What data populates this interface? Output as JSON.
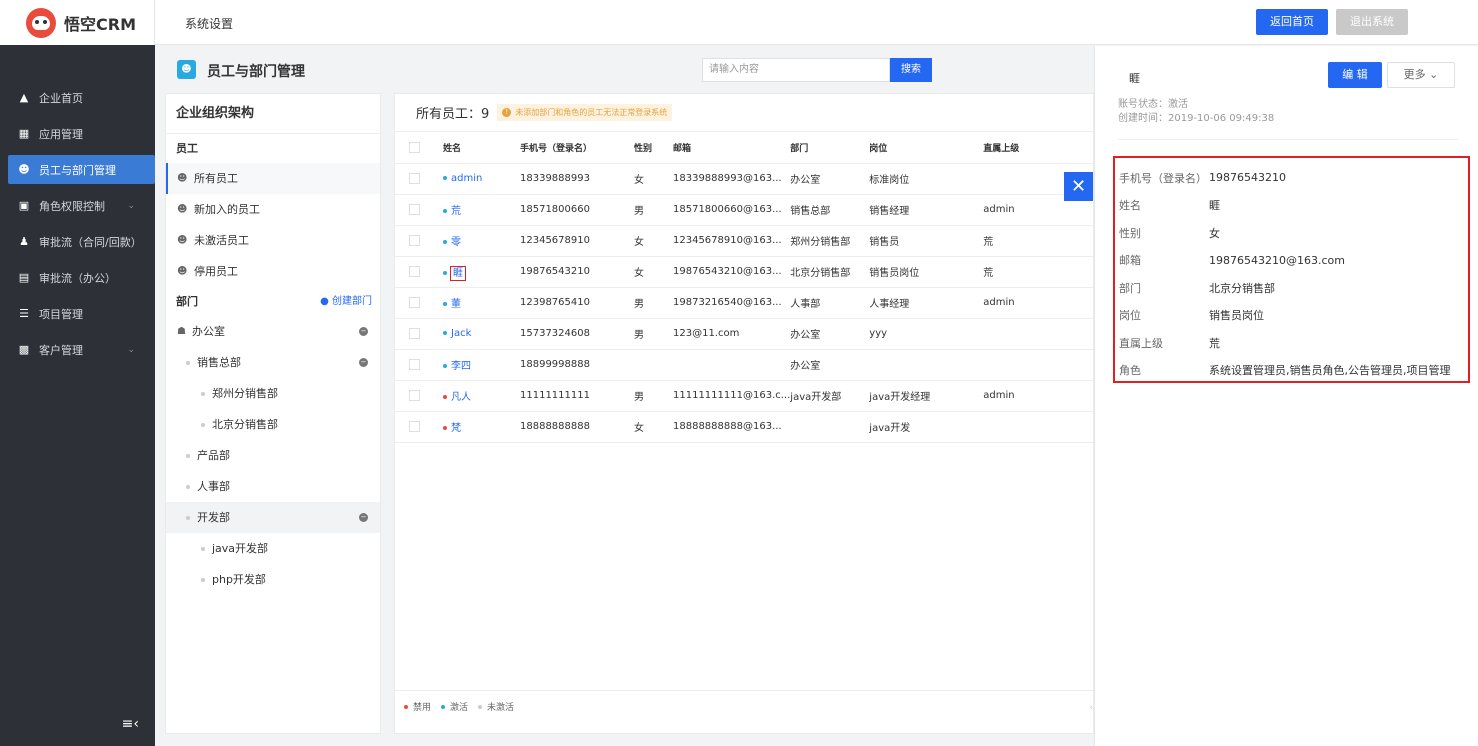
{
  "app": {
    "name": "悟空CRM"
  },
  "sidebar": {
    "items": [
      {
        "label": "企业首页",
        "icon": "home-icon"
      },
      {
        "label": "应用管理",
        "icon": "apps-icon"
      },
      {
        "label": "员工与部门管理",
        "icon": "users-icon",
        "active": true
      },
      {
        "label": "角色权限控制",
        "icon": "role-icon",
        "has_children": true
      },
      {
        "label": "审批流（合同/回款）",
        "icon": "approval-icon"
      },
      {
        "label": "审批流（办公）",
        "icon": "office-icon"
      },
      {
        "label": "项目管理",
        "icon": "project-icon"
      },
      {
        "label": "客户管理",
        "icon": "customer-icon",
        "has_children": true
      }
    ]
  },
  "header": {
    "title": "系统设置",
    "home_button": "返回首页",
    "logout_button": "退出系统"
  },
  "page": {
    "title": "员工与部门管理",
    "search_placeholder": "请输入内容",
    "search_button": "搜索"
  },
  "org": {
    "title": "企业组织架构",
    "employee_section": "员工",
    "employee_filters": [
      "所有员工",
      "新加入的员工",
      "未激活员工",
      "停用员工"
    ],
    "dept_section": "部门",
    "create_dept": "创建部门",
    "depts": [
      {
        "label": "办公室",
        "level": 0,
        "toggle": true
      },
      {
        "label": "销售总部",
        "level": 1,
        "toggle": true
      },
      {
        "label": "郑州分销售部",
        "level": 2
      },
      {
        "label": "北京分销售部",
        "level": 2
      },
      {
        "label": "产品部",
        "level": 1
      },
      {
        "label": "人事部",
        "level": 1
      },
      {
        "label": "开发部",
        "level": 1,
        "toggle": true,
        "active": true
      },
      {
        "label": "java开发部",
        "level": 2
      },
      {
        "label": "php开发部",
        "level": 2
      }
    ]
  },
  "employees": {
    "count_label": "所有员工：9",
    "warning": "未添加部门和角色的员工无法正常登录系统",
    "columns": [
      "姓名",
      "手机号（登录名）",
      "性别",
      "邮箱",
      "部门",
      "岗位",
      "直属上级"
    ],
    "rows": [
      {
        "name": "admin",
        "status": "active",
        "phone": "18339888993",
        "gender": "女",
        "email": "18339888993@163...",
        "dept": "办公室",
        "post": "标准岗位",
        "leader": ""
      },
      {
        "name": "荒",
        "status": "active",
        "phone": "18571800660",
        "gender": "男",
        "email": "18571800660@163...",
        "dept": "销售总部",
        "post": "销售经理",
        "leader": "admin"
      },
      {
        "name": "零",
        "status": "active",
        "phone": "12345678910",
        "gender": "女",
        "email": "12345678910@163...",
        "dept": "郑州分销售部",
        "post": "销售员",
        "leader": "荒"
      },
      {
        "name": "睚",
        "status": "active",
        "phone": "19876543210",
        "gender": "女",
        "email": "19876543210@163...",
        "dept": "北京分销售部",
        "post": "销售员岗位",
        "leader": "荒",
        "highlight": true
      },
      {
        "name": "董",
        "status": "active",
        "phone": "12398765410",
        "gender": "男",
        "email": "19873216540@163...",
        "dept": "人事部",
        "post": "人事经理",
        "leader": "admin"
      },
      {
        "name": "Jack",
        "status": "active",
        "phone": "15737324608",
        "gender": "男",
        "email": "123@11.com",
        "dept": "办公室",
        "post": "yyy",
        "leader": ""
      },
      {
        "name": "李四",
        "status": "active",
        "phone": "18899998888",
        "gender": "",
        "email": "",
        "dept": "办公室",
        "post": "",
        "leader": ""
      },
      {
        "name": "凡人",
        "status": "disabled",
        "phone": "11111111111",
        "gender": "男",
        "email": "11111111111@163.c...",
        "dept": "java开发部",
        "post": "java开发经理",
        "leader": "admin"
      },
      {
        "name": "梵",
        "status": "disabled",
        "phone": "18888888888",
        "gender": "女",
        "email": "18888888888@163...",
        "dept": "",
        "post": "java开发",
        "leader": ""
      }
    ],
    "legend": [
      {
        "label": "禁用",
        "color": "#e74c3c"
      },
      {
        "label": "激活",
        "color": "#2aa9e0"
      },
      {
        "label": "未激活",
        "color": "#cccccc"
      }
    ]
  },
  "detail": {
    "name": "睚",
    "edit_button": "编 辑",
    "more_button": "更多",
    "status": "账号状态：激活",
    "created": "创建时间：2019-10-06 09:49:38",
    "fields": [
      {
        "k": "手机号（登录名）",
        "v": "19876543210"
      },
      {
        "k": "姓名",
        "v": "睚"
      },
      {
        "k": "性别",
        "v": "女"
      },
      {
        "k": "邮箱",
        "v": "19876543210@163.com"
      },
      {
        "k": "部门",
        "v": "北京分销售部"
      },
      {
        "k": "岗位",
        "v": "销售员岗位"
      },
      {
        "k": "直属上级",
        "v": "荒"
      },
      {
        "k": "角色",
        "v": "系统设置管理员,销售员角色,公告管理员,项目管理"
      }
    ]
  }
}
